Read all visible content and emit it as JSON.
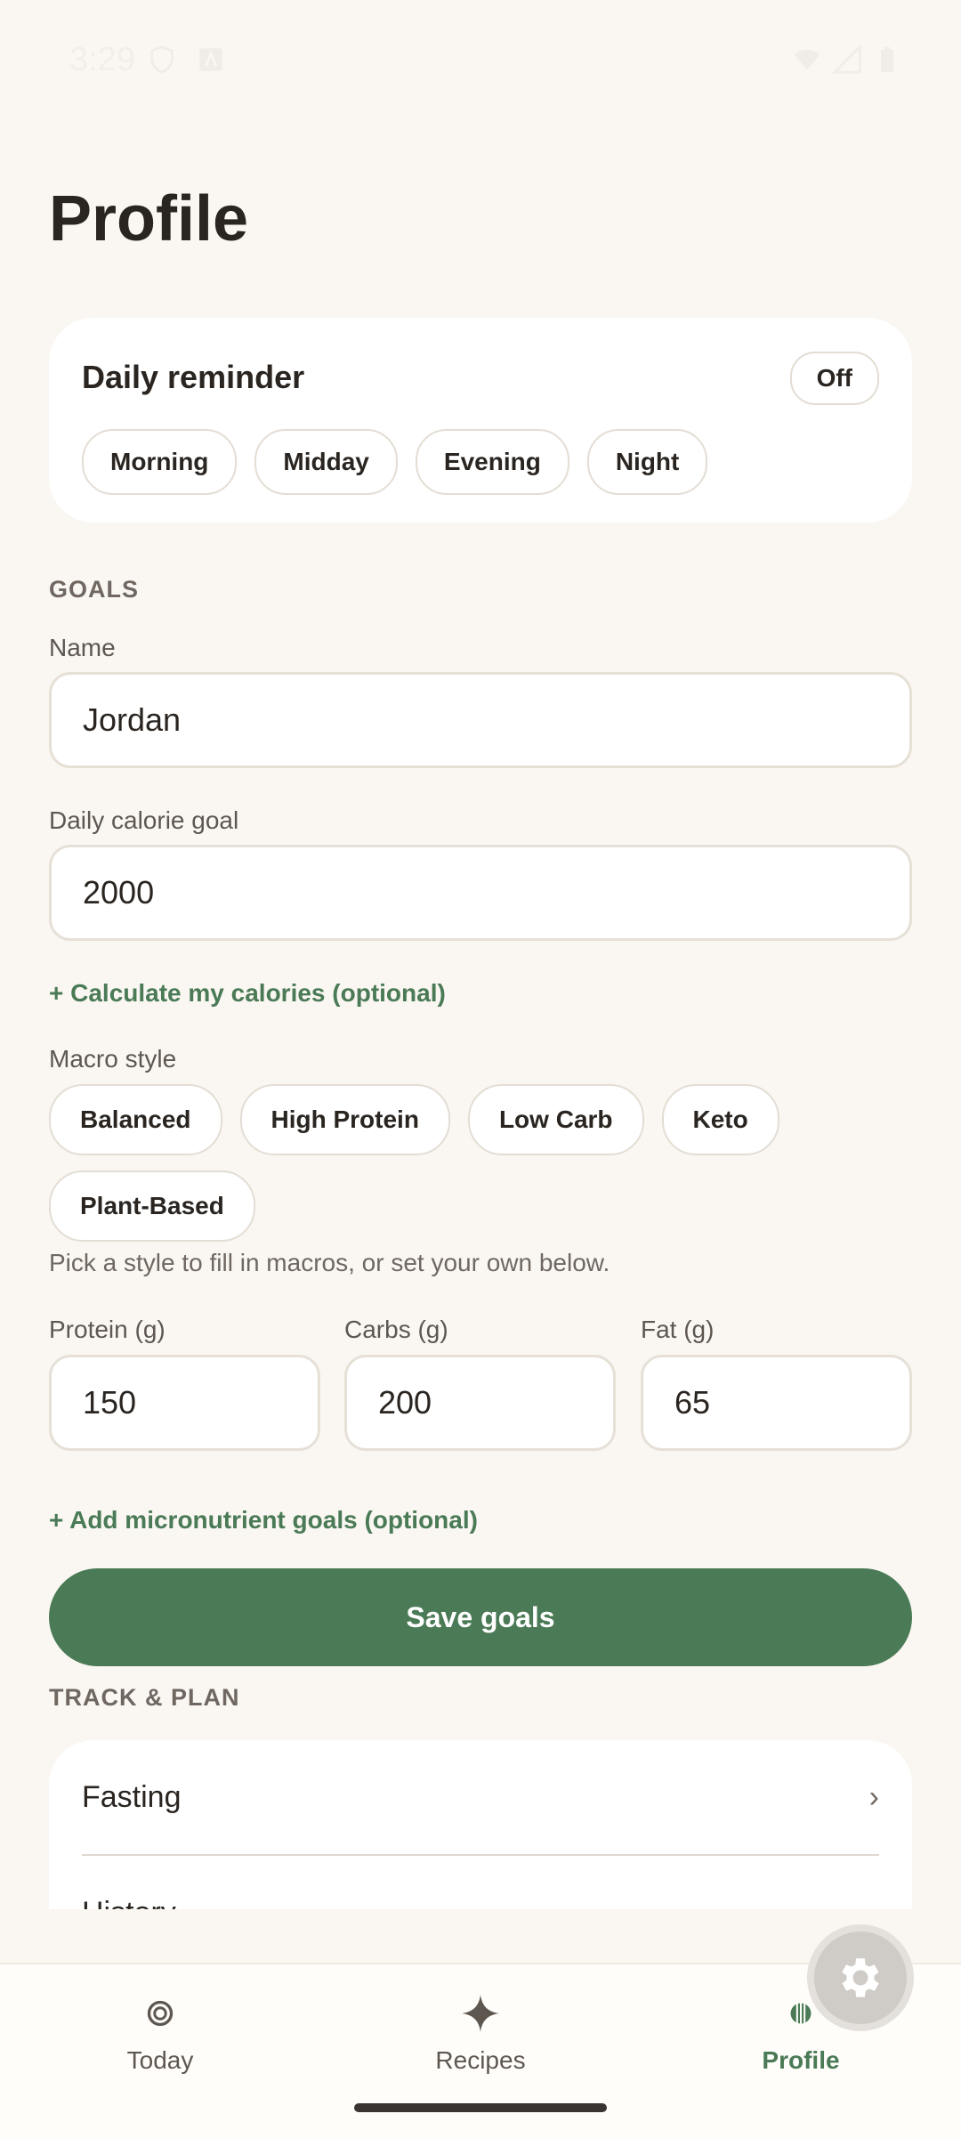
{
  "status": {
    "time": "3:29"
  },
  "page": {
    "title": "Profile"
  },
  "reminder": {
    "title": "Daily reminder",
    "toggle": "Off",
    "times": [
      "Morning",
      "Midday",
      "Evening",
      "Night"
    ]
  },
  "goals": {
    "section": "GOALS",
    "name_label": "Name",
    "name_value": "Jordan",
    "calorie_label": "Daily calorie goal",
    "calorie_value": "2000",
    "calculate_link": "+ Calculate my calories (optional)",
    "macro_label": "Macro style",
    "macro_styles": [
      "Balanced",
      "High Protein",
      "Low Carb",
      "Keto",
      "Plant-Based"
    ],
    "macro_helper": "Pick a style to fill in macros, or set your own below.",
    "protein_label": "Protein (g)",
    "protein_value": "150",
    "carbs_label": "Carbs (g)",
    "carbs_value": "200",
    "fat_label": "Fat (g)",
    "fat_value": "65",
    "micro_link": "+ Add micronutrient goals (optional)",
    "save": "Save goals"
  },
  "track": {
    "section": "TRACK & PLAN",
    "items": [
      "Fasting",
      "History"
    ]
  },
  "nav": {
    "items": [
      {
        "label": "Today",
        "icon": "circle-target-icon"
      },
      {
        "label": "Recipes",
        "icon": "sparkle-icon"
      },
      {
        "label": "Profile",
        "icon": "striped-circle-icon"
      }
    ],
    "active": "Profile"
  },
  "colors": {
    "accent": "#4a7a56",
    "background": "#faf7f2",
    "card": "#ffffff"
  }
}
